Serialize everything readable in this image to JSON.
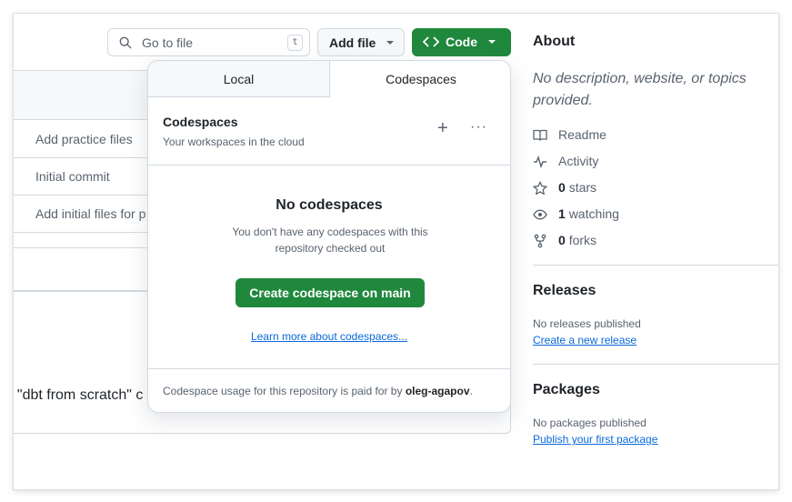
{
  "toolbar": {
    "search_placeholder": "Go to file",
    "search_shortcut": "t",
    "add_file_label": "Add file",
    "code_label": "Code"
  },
  "files": {
    "commit_messages": [
      "Add practice files",
      "Initial commit",
      "Add initial files for p"
    ],
    "readme_fragment": "f \"dbt from scratch\" c"
  },
  "dropdown": {
    "tabs": [
      "Local",
      "Codespaces"
    ],
    "active_tab": "Codespaces",
    "heading": "Codespaces",
    "subheading": "Your workspaces in the cloud",
    "empty_title": "No codespaces",
    "empty_desc": "You don't have any codespaces with this repository checked out",
    "create_button": "Create codespace on main",
    "learn_link": "Learn more about codespaces...",
    "footer_prefix": "Codespace usage for this repository is paid for by ",
    "footer_user": "oleg-agapov",
    "footer_suffix": "."
  },
  "about": {
    "title": "About",
    "description": "No description, website, or topics provided.",
    "readme": "Readme",
    "activity": "Activity",
    "stars_count": "0",
    "stars_label": "stars",
    "watching_count": "1",
    "watching_label": "watching",
    "forks_count": "0",
    "forks_label": "forks"
  },
  "releases": {
    "title": "Releases",
    "none_text": "No releases published",
    "create_link": "Create a new release"
  },
  "packages": {
    "title": "Packages",
    "none_text": "No packages published",
    "publish_link": "Publish your first package"
  },
  "colors": {
    "primary_green": "#1f883d",
    "link_blue": "#0969da",
    "border": "#d1d9e0"
  }
}
